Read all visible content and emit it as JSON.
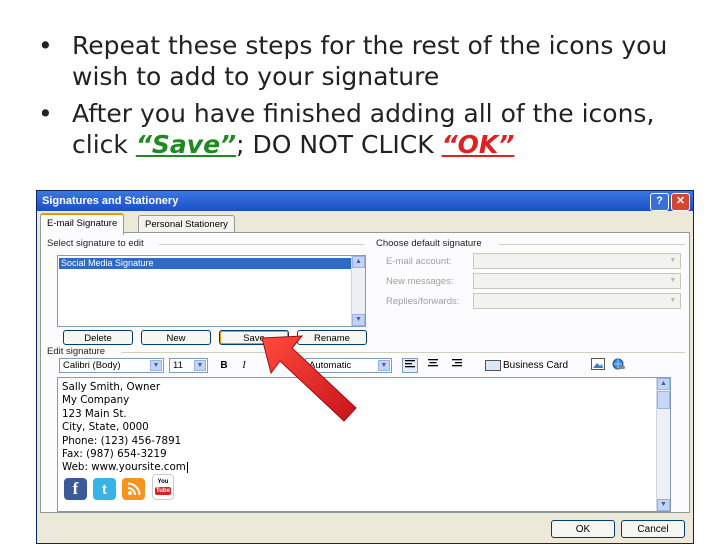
{
  "slide": {
    "bullet1": "Repeat these steps for the rest of the icons you wish to add to your signature",
    "bullet2_pre": "After you have finished adding all of the icons, click ",
    "bullet2_save": "“Save”",
    "bullet2_mid": "; DO NOT CLICK ",
    "bullet2_ok": "“OK”",
    "bullet_glyph": "•"
  },
  "dialog": {
    "title": "Signatures and Stationery",
    "help_label": "?",
    "close_label": "✕",
    "tabs": [
      {
        "label": "E-mail Signature",
        "active": true
      },
      {
        "label": "Personal Stationery",
        "active": false
      }
    ],
    "select_label": "Select signature to edit",
    "signatures": [
      "Social Media Signature"
    ],
    "buttons": {
      "delete": "Delete",
      "new": "New",
      "save": "Save",
      "rename": "Rename"
    },
    "defaults": {
      "label": "Choose default signature",
      "email_account": "E-mail account:",
      "new_messages": "New messages:",
      "replies": "Replies/forwards:"
    },
    "edit_label": "Edit signature",
    "font": "Calibri (Body)",
    "size": "11",
    "bold": "B",
    "italic": "I",
    "color": "Automatic",
    "business_card": "Business Card",
    "signature_lines": [
      "Sally Smith, Owner",
      "My Company",
      "123 Main St.",
      "City, State, 0000",
      "Phone: (123) 456-7891",
      "Fax: (987) 654-3219",
      "Web: www.yoursite.com"
    ],
    "social_icons": [
      "facebook-icon",
      "twitter-icon",
      "rss-icon",
      "youtube-icon"
    ],
    "youtube_text": "You Tube",
    "ok": "OK",
    "cancel": "Cancel"
  },
  "colors": {
    "save_keyword": "#1f8a1f",
    "ok_keyword": "#e02020",
    "arrow": "#e42a2a",
    "titlebar": "#1b4fc4",
    "selection": "#316ac5"
  }
}
